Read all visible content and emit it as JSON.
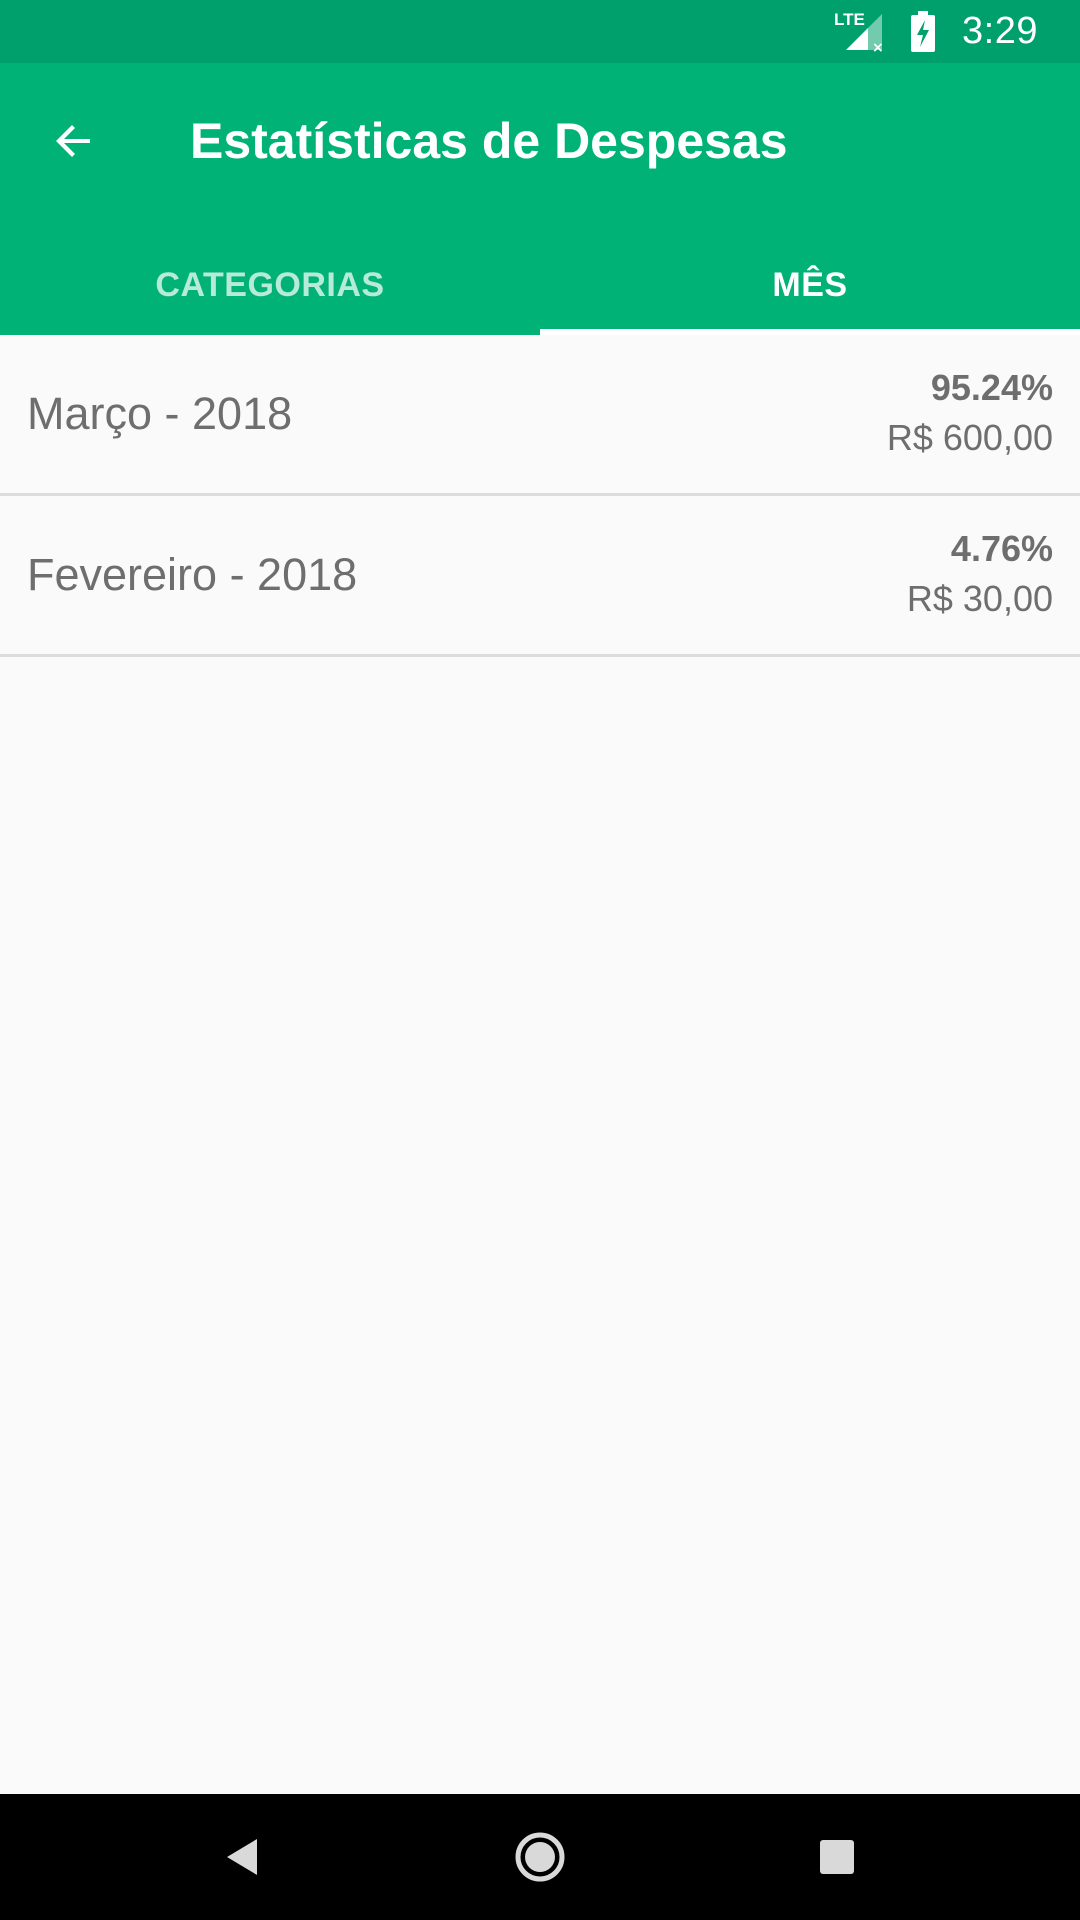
{
  "status_bar": {
    "time": "3:29",
    "network_label": "LTE",
    "icons": [
      "signal-icon",
      "battery-charging-icon"
    ]
  },
  "app_bar": {
    "title": "Estatísticas de Despesas",
    "back_icon": "arrow-back-icon"
  },
  "tabs": [
    {
      "label": "CATEGORIAS",
      "selected": false
    },
    {
      "label": "MÊS",
      "selected": true
    }
  ],
  "list": {
    "items": [
      {
        "label": "Março - 2018",
        "percent": "95.24%",
        "amount": "R$ 600,00"
      },
      {
        "label": "Fevereiro - 2018",
        "percent": "4.76%",
        "amount": "R$ 30,00"
      }
    ]
  },
  "nav_bar": {
    "icons": [
      "back-triangle-icon",
      "home-circle-icon",
      "recents-square-icon"
    ]
  },
  "colors": {
    "status_bar": "#00a06c",
    "app_bar": "#01b277",
    "background": "#fafafa",
    "text_secondary": "#6e6e6e",
    "divider": "#dcdcdc",
    "nav_bar": "#000000"
  }
}
